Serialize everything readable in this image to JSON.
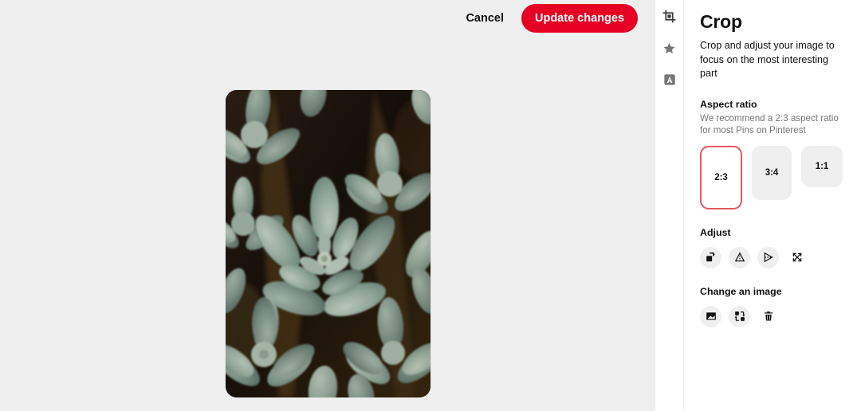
{
  "header": {
    "cancel_label": "Cancel",
    "update_label": "Update changes"
  },
  "colors": {
    "brand_red": "#e60023",
    "selected_border": "#e8575f",
    "canvas_bg": "#efefef",
    "tile_bg": "#efefef",
    "text_primary": "#111111",
    "text_secondary": "#767676"
  },
  "rail": {
    "items": [
      {
        "icon": "crop-icon",
        "name": "rail-item-crop",
        "active": true
      },
      {
        "icon": "star-icon",
        "name": "rail-item-effects",
        "active": false
      },
      {
        "icon": "text-box-icon",
        "name": "rail-item-text",
        "active": false
      }
    ]
  },
  "panel": {
    "title": "Crop",
    "subtitle": "Crop and adjust your image to focus on the most interesting part",
    "aspect_ratio": {
      "label": "Aspect ratio",
      "hint": "We recommend a 2:3 aspect ratio for most Pins on Pinterest",
      "options": [
        {
          "label": "2:3",
          "selected": true
        },
        {
          "label": "3:4",
          "selected": false
        },
        {
          "label": "1:1",
          "selected": false
        }
      ]
    },
    "adjust": {
      "label": "Adjust",
      "actions": [
        {
          "icon": "rotate-icon",
          "name": "rotate-button"
        },
        {
          "icon": "flip-vertical-icon",
          "name": "flip-vertical-button"
        },
        {
          "icon": "flip-horizontal-icon",
          "name": "flip-horizontal-button"
        },
        {
          "icon": "expand-icon",
          "name": "expand-button"
        }
      ]
    },
    "change_image": {
      "label": "Change an image",
      "actions": [
        {
          "icon": "image-icon",
          "name": "upload-image-button"
        },
        {
          "icon": "swap-icon",
          "name": "replace-image-button"
        },
        {
          "icon": "trash-icon",
          "name": "delete-image-button"
        }
      ]
    }
  },
  "image": {
    "alt": "succulent-plants-photo",
    "crop_ratio": "2:3"
  }
}
